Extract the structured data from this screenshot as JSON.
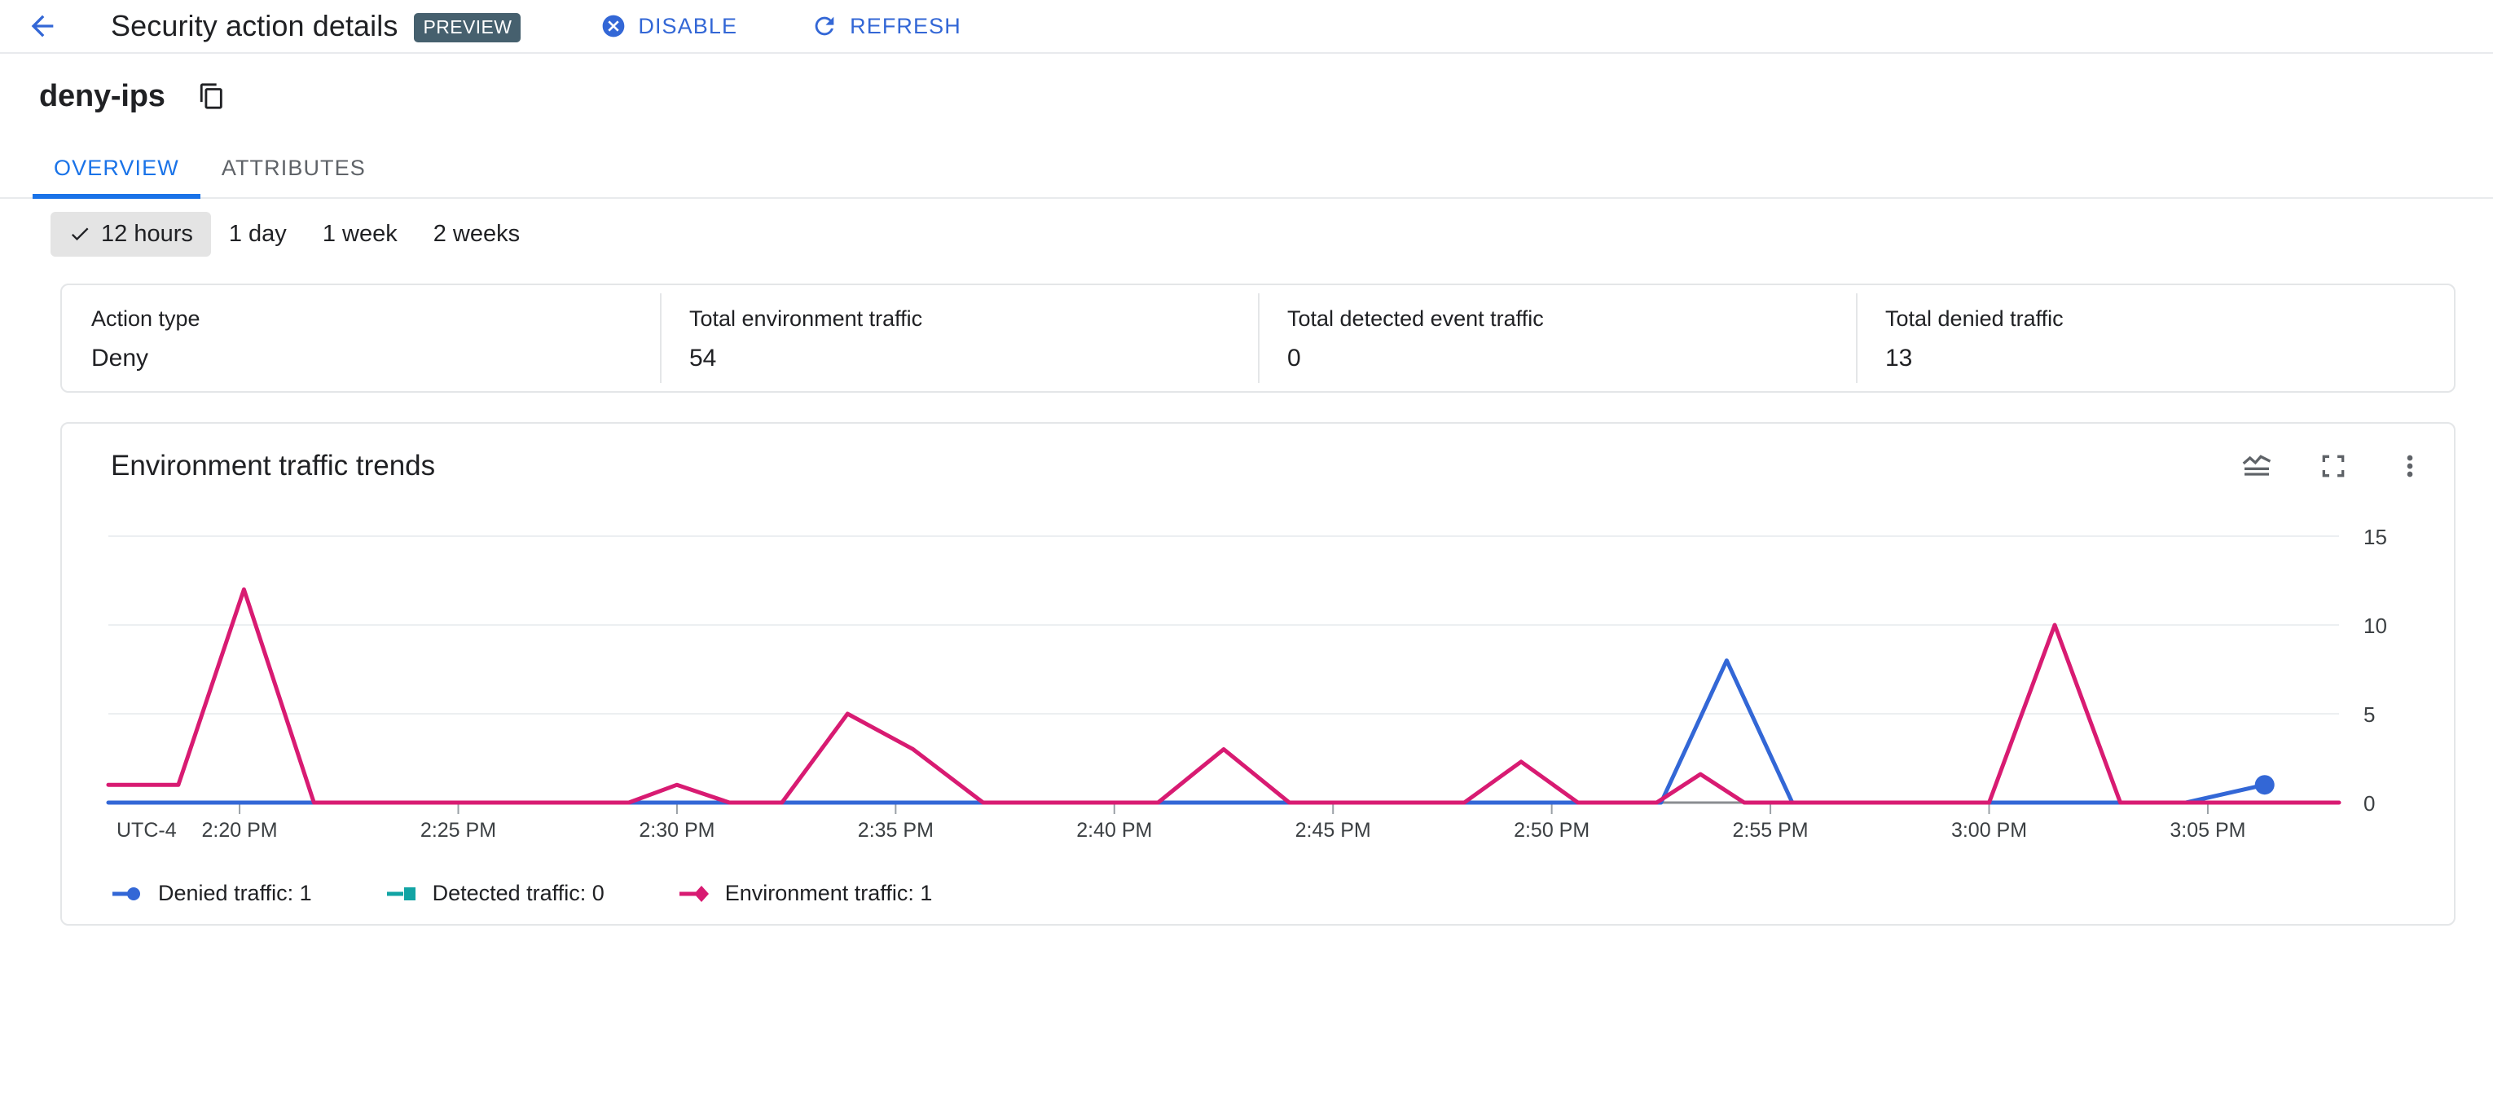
{
  "topbar": {
    "back_icon": "arrow-back-icon",
    "title": "Security action details",
    "preview_badge": "PREVIEW",
    "actions": [
      {
        "label": "DISABLE",
        "icon": "cancel-icon"
      },
      {
        "label": "REFRESH",
        "icon": "refresh-icon"
      }
    ],
    "accent_color": "#3367d6",
    "badge_color": "#46606e"
  },
  "resource": {
    "name": "deny-ips",
    "copy_icon": "copy-icon"
  },
  "tabs": [
    {
      "label": "OVERVIEW",
      "active": true
    },
    {
      "label": "ATTRIBUTES",
      "active": false
    }
  ],
  "time_ranges": [
    {
      "label": "12 hours",
      "selected": true
    },
    {
      "label": "1 day",
      "selected": false
    },
    {
      "label": "1 week",
      "selected": false
    },
    {
      "label": "2 weeks",
      "selected": false
    }
  ],
  "stats": [
    {
      "label": "Action type",
      "value": "Deny"
    },
    {
      "label": "Total environment traffic",
      "value": "54"
    },
    {
      "label": "Total detected event traffic",
      "value": "0"
    },
    {
      "label": "Total denied traffic",
      "value": "13"
    }
  ],
  "chart_card": {
    "title": "Environment traffic trends",
    "icons": [
      {
        "name": "chart-type-icon"
      },
      {
        "name": "fullscreen-icon"
      },
      {
        "name": "more-vert-icon"
      }
    ]
  },
  "chart_data": {
    "type": "line",
    "title": "Environment traffic trends",
    "xlabel": "",
    "ylabel": "",
    "timezone_label": "UTC-4",
    "grid": true,
    "legend_position": "bottom-left",
    "ylim": [
      0,
      15
    ],
    "yticks": [
      0,
      5,
      10,
      15
    ],
    "xticks": [
      "2:20 PM",
      "2:25 PM",
      "2:30 PM",
      "2:35 PM",
      "2:40 PM",
      "2:45 PM",
      "2:50 PM",
      "2:55 PM",
      "3:00 PM",
      "3:05 PM"
    ],
    "xlim_minutes": [
      137,
      188
    ],
    "series": [
      {
        "name": "Denied traffic",
        "legend_label": "Denied traffic: 1",
        "color": "#3367d6",
        "marker": "circle",
        "points": [
          [
            137,
            0
          ],
          [
            170.5,
            0
          ],
          [
            172.5,
            0
          ],
          [
            174.0,
            8
          ],
          [
            175.5,
            0
          ],
          [
            184.5,
            0
          ],
          [
            186.3,
            1
          ]
        ],
        "end_marker": true
      },
      {
        "name": "Detected traffic",
        "legend_label": "Detected traffic: 0",
        "color": "#12a4a4",
        "marker": "square",
        "points": [
          [
            137,
            0
          ],
          [
            188,
            0
          ]
        ]
      },
      {
        "name": "Environment traffic",
        "legend_label": "Environment traffic: 1",
        "color": "#d81b72",
        "marker": "diamond",
        "points": [
          [
            137,
            1
          ],
          [
            138.6,
            1
          ],
          [
            140.1,
            12
          ],
          [
            141.7,
            0
          ],
          [
            148.9,
            0
          ],
          [
            150.0,
            1
          ],
          [
            151.2,
            0
          ],
          [
            152.4,
            0
          ],
          [
            153.9,
            5
          ],
          [
            155.4,
            3
          ],
          [
            157.0,
            0
          ],
          [
            161.0,
            0
          ],
          [
            162.5,
            3
          ],
          [
            164.0,
            0
          ],
          [
            168.0,
            0
          ],
          [
            169.3,
            2.3
          ],
          [
            170.6,
            0
          ],
          [
            172.4,
            0
          ],
          [
            173.4,
            1.6
          ],
          [
            174.4,
            0
          ],
          [
            180.0,
            0
          ],
          [
            181.5,
            10
          ],
          [
            183.0,
            0
          ],
          [
            188,
            0
          ]
        ]
      }
    ]
  }
}
